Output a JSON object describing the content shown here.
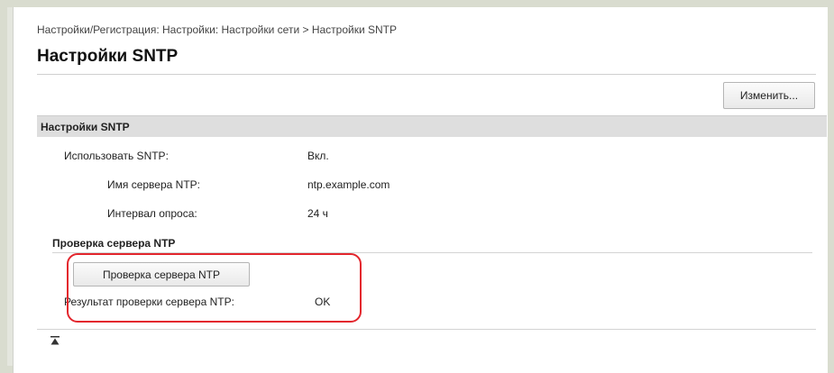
{
  "breadcrumb": "Настройки/Регистрация: Настройки: Настройки сети > Настройки SNTP",
  "title": "Настройки SNTP",
  "edit_button": "Изменить...",
  "section_header": "Настройки SNTP",
  "settings": [
    {
      "label": "Использовать SNTP:",
      "value": "Вкл."
    },
    {
      "label": "Имя сервера NTP:",
      "value": "ntp.example.com"
    },
    {
      "label": "Интервал опроса:",
      "value": "24 ч"
    }
  ],
  "check_section": {
    "header": "Проверка сервера NTP",
    "button": "Проверка сервера NTP",
    "result_label": "Результат проверки сервера NTP:",
    "result_value": "OK"
  },
  "icons": {
    "back_to_top": "arrow-to-top-icon"
  },
  "colors": {
    "highlight": "#e3262d",
    "section_header_bg": "#dedede"
  }
}
